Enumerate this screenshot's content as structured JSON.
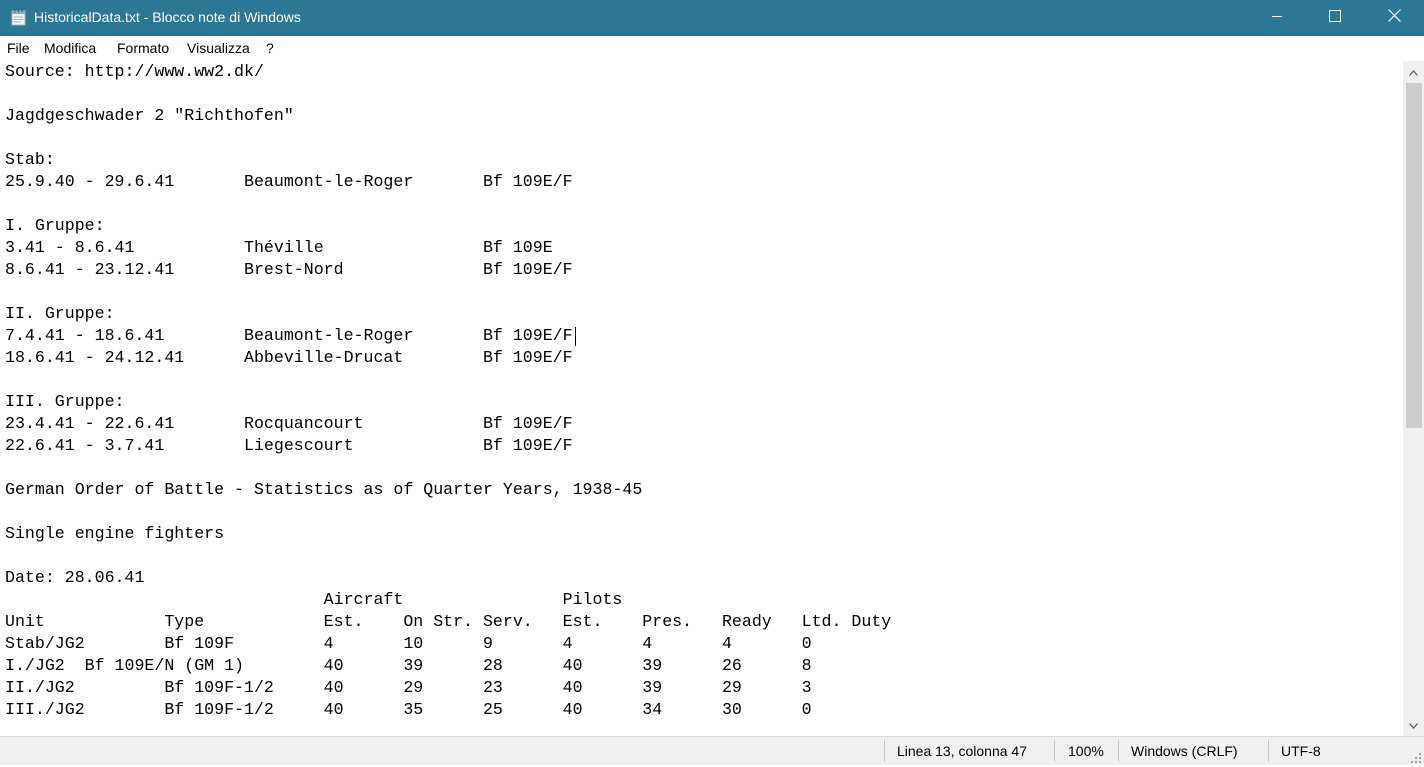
{
  "window": {
    "title": "HistoricalData.txt - Blocco note di Windows",
    "accent_color": "#2b7794",
    "icons": {
      "app": "notepad-icon",
      "minimize": "minimize-icon",
      "maximize": "maximize-icon",
      "close": "close-icon"
    }
  },
  "menu": {
    "file": "File",
    "edit": "Modifica",
    "format": "Formato",
    "view": "Visualizza",
    "help": "?"
  },
  "editor": {
    "content": "Source: http://www.ww2.dk/\n\nJagdgeschwader 2 \"Richthofen\"\n\nStab:\n25.9.40 - 29.6.41       Beaumont-le-Roger       Bf 109E/F\n\nI. Gruppe:\n3.41 - 8.6.41           Théville                Bf 109E\n8.6.41 - 23.12.41       Brest-Nord              Bf 109E/F\n\nII. Gruppe:\n7.4.41 - 18.6.41        Beaumont-le-Roger       Bf 109E/F\n18.6.41 - 24.12.41      Abbeville-Drucat        Bf 109E/F\n\nIII. Gruppe:\n23.4.41 - 22.6.41       Rocquancourt            Bf 109E/F\n22.6.41 - 3.7.41        Liegescourt             Bf 109E/F\n\nGerman Order of Battle - Statistics as of Quarter Years, 1938-45\n\nSingle engine fighters\n\nDate: 28.06.41\n                                Aircraft                Pilots\nUnit            Type            Est.    On Str. Serv.   Est.    Pres.   Ready   Ltd. Duty\nStab/JG2        Bf 109F         4       10      9       4       4       4       0\nI./JG2  Bf 109E/N (GM 1)        40      39      28      40      39      26      8\nII./JG2         Bf 109F-1/2     40      29      23      40      39      29      3\nIII./JG2        Bf 109F-1/2     40      35      25      40      34      30      0"
  },
  "scrollbar": {
    "up_icon": "chevron-up-icon",
    "down_icon": "chevron-down-icon"
  },
  "status": {
    "position": "Linea 13, colonna 47",
    "zoom": "100%",
    "line_ending": "Windows (CRLF)",
    "encoding": "UTF-8"
  }
}
